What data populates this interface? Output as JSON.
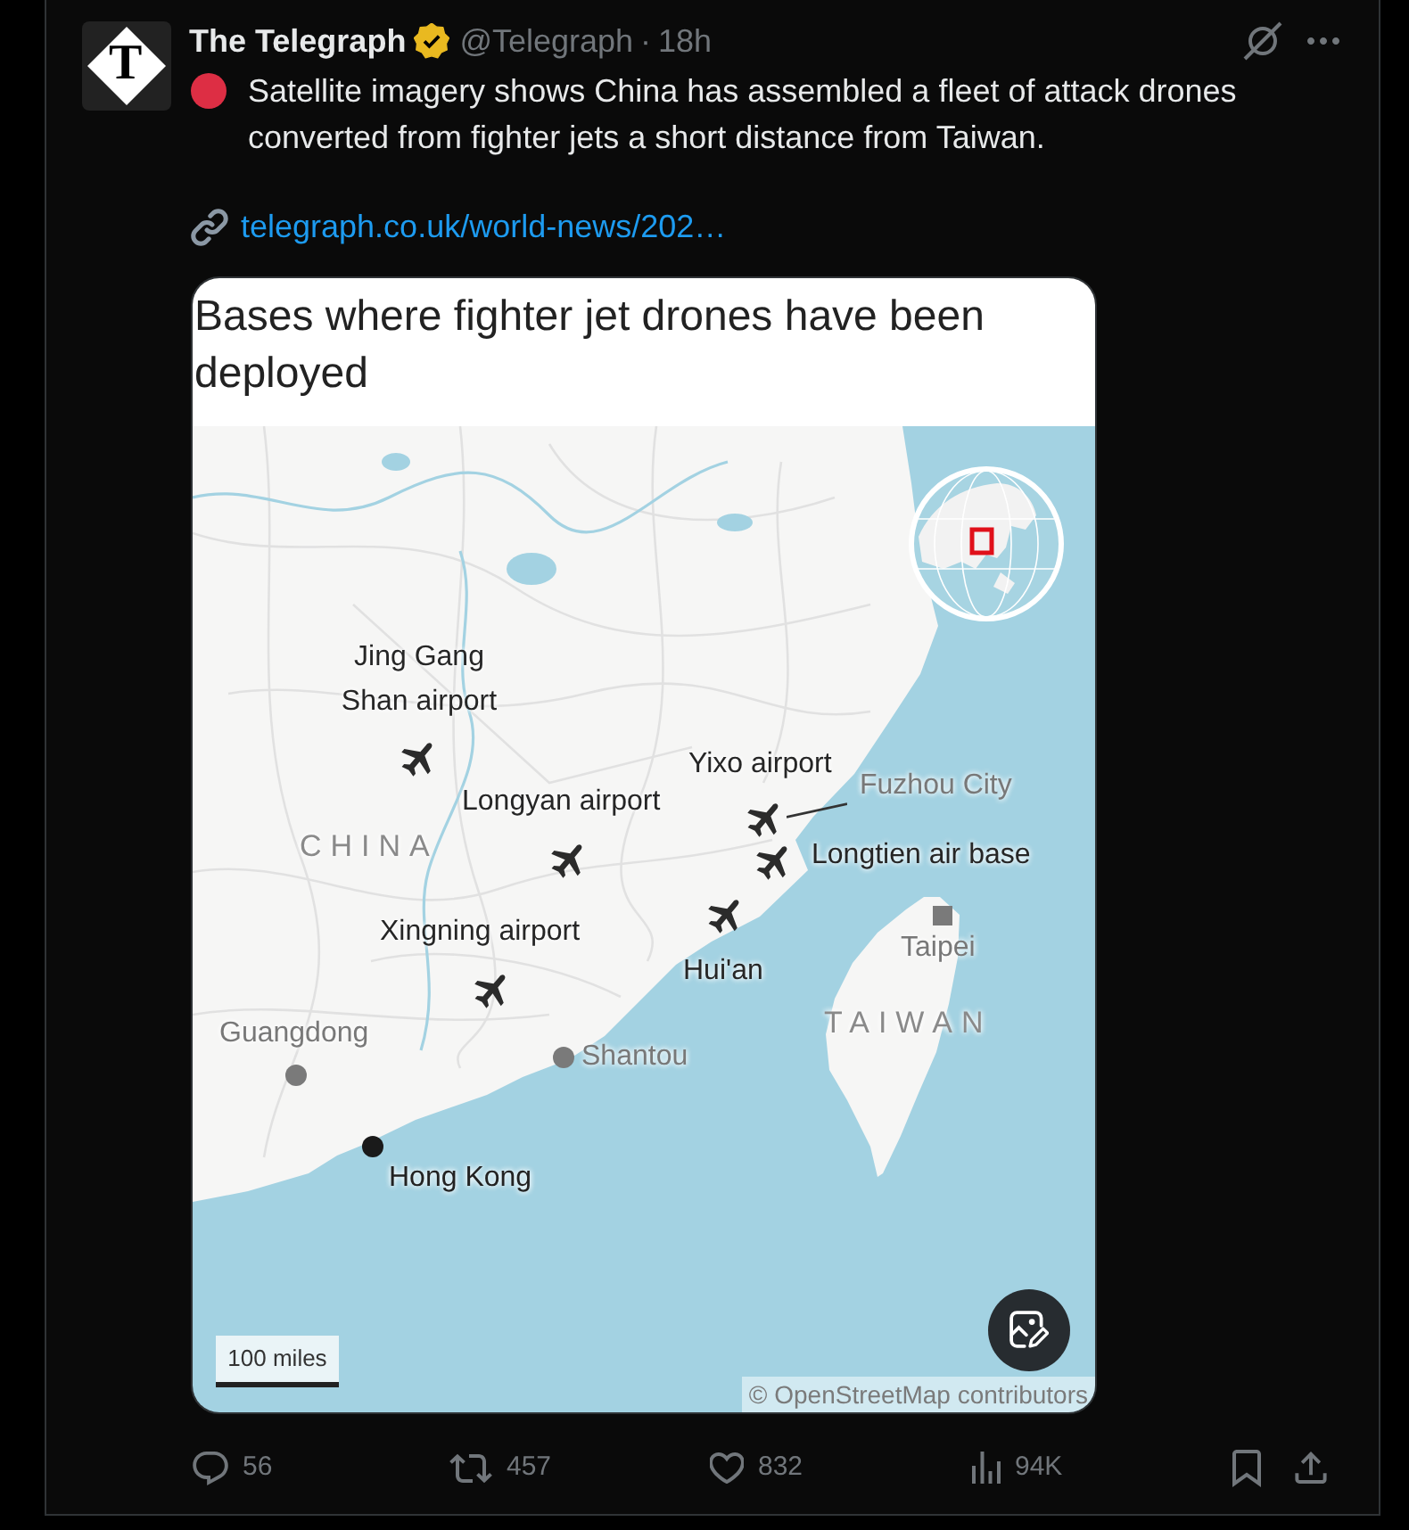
{
  "tweet": {
    "author": {
      "name": "The Telegraph",
      "logo_letter": "T",
      "verified": true,
      "handle": "@Telegraph",
      "separator": "·",
      "time": "18h"
    },
    "text": "Satellite imagery shows China has assembled a fleet of attack drones converted from fighter jets a short distance from Taiwan.",
    "link": "telegraph.co.uk/world-news/202…",
    "media": {
      "title": "Bases where fighter jet drones have been deployed",
      "bases": [
        "Jing Gang Shan airport",
        "Longyan airport",
        "Yixo airport",
        "Longtien air base",
        "Xingning airport",
        "Hui'an"
      ],
      "places": [
        {
          "kind": "leader",
          "label": "Fuzhou City"
        },
        {
          "kind": "capital",
          "label": "Taipei"
        },
        {
          "kind": "city",
          "label": "Guangdong"
        },
        {
          "kind": "city",
          "label": "Shantou"
        },
        {
          "kind": "major",
          "label": "Hong Kong"
        }
      ],
      "regions": [
        "CHINA",
        "TAIWAN"
      ],
      "scale": "100 miles",
      "credit": "© OpenStreetMap contributors"
    },
    "actions": [
      {
        "kind": "reply",
        "count": "56"
      },
      {
        "kind": "repost",
        "count": "457"
      },
      {
        "kind": "like",
        "count": "832"
      },
      {
        "kind": "views",
        "count": "94K"
      },
      {
        "kind": "bookmark"
      },
      {
        "kind": "share"
      }
    ]
  }
}
